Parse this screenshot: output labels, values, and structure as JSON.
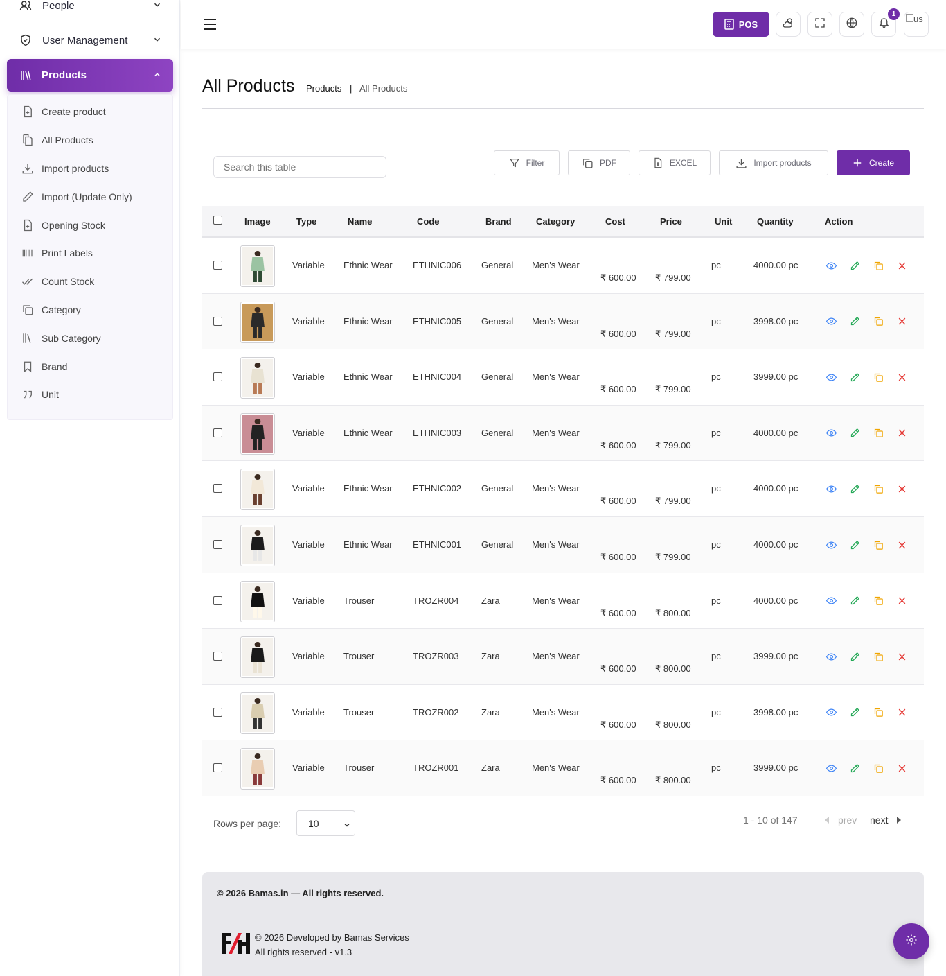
{
  "sidebar": {
    "top_items": [
      {
        "label": "People"
      },
      {
        "label": "User Management"
      }
    ],
    "active": {
      "label": "Products"
    },
    "sub_items": [
      {
        "label": "Create product"
      },
      {
        "label": "All Products"
      },
      {
        "label": "Import products"
      },
      {
        "label": "Import (Update Only)"
      },
      {
        "label": "Opening Stock"
      },
      {
        "label": "Print Labels"
      },
      {
        "label": "Count Stock"
      },
      {
        "label": "Category"
      },
      {
        "label": "Sub Category"
      },
      {
        "label": "Brand"
      },
      {
        "label": "Unit"
      }
    ]
  },
  "header": {
    "pos_label": "POS",
    "notification_count": "1",
    "avatar_alt": "us"
  },
  "page": {
    "title": "All Products",
    "breadcrumb": [
      "Products",
      "|",
      "All Products"
    ]
  },
  "toolbar": {
    "search_placeholder": "Search this table",
    "filter_label": "Filter",
    "pdf_label": "PDF",
    "excel_label": "EXCEL",
    "import_label": "Import products",
    "create_label": "Create"
  },
  "table": {
    "columns": [
      "Image",
      "Type",
      "Name",
      "Code",
      "Brand",
      "Category",
      "Cost",
      "Price",
      "Unit",
      "Quantity",
      "Action"
    ],
    "rows": [
      {
        "type": "Variable",
        "name": "Ethnic Wear",
        "code": "ETHNIC006",
        "brand": "General",
        "category": "Men's Wear",
        "cost": "₹ 600.00",
        "price": "₹ 799.00",
        "unit": "pc",
        "quantity": "4000.00 pc"
      },
      {
        "type": "Variable",
        "name": "Ethnic Wear",
        "code": "ETHNIC005",
        "brand": "General",
        "category": "Men's Wear",
        "cost": "₹ 600.00",
        "price": "₹ 799.00",
        "unit": "pc",
        "quantity": "3998.00 pc"
      },
      {
        "type": "Variable",
        "name": "Ethnic Wear",
        "code": "ETHNIC004",
        "brand": "General",
        "category": "Men's Wear",
        "cost": "₹ 600.00",
        "price": "₹ 799.00",
        "unit": "pc",
        "quantity": "3999.00 pc"
      },
      {
        "type": "Variable",
        "name": "Ethnic Wear",
        "code": "ETHNIC003",
        "brand": "General",
        "category": "Men's Wear",
        "cost": "₹ 600.00",
        "price": "₹ 799.00",
        "unit": "pc",
        "quantity": "4000.00 pc"
      },
      {
        "type": "Variable",
        "name": "Ethnic Wear",
        "code": "ETHNIC002",
        "brand": "General",
        "category": "Men's Wear",
        "cost": "₹ 600.00",
        "price": "₹ 799.00",
        "unit": "pc",
        "quantity": "4000.00 pc"
      },
      {
        "type": "Variable",
        "name": "Ethnic Wear",
        "code": "ETHNIC001",
        "brand": "General",
        "category": "Men's Wear",
        "cost": "₹ 600.00",
        "price": "₹ 799.00",
        "unit": "pc",
        "quantity": "4000.00 pc"
      },
      {
        "type": "Variable",
        "name": "Trouser",
        "code": "TROZR004",
        "brand": "Zara",
        "category": "Men's Wear",
        "cost": "₹ 600.00",
        "price": "₹ 800.00",
        "unit": "pc",
        "quantity": "4000.00 pc"
      },
      {
        "type": "Variable",
        "name": "Trouser",
        "code": "TROZR003",
        "brand": "Zara",
        "category": "Men's Wear",
        "cost": "₹ 600.00",
        "price": "₹ 800.00",
        "unit": "pc",
        "quantity": "3999.00 pc"
      },
      {
        "type": "Variable",
        "name": "Trouser",
        "code": "TROZR002",
        "brand": "Zara",
        "category": "Men's Wear",
        "cost": "₹ 600.00",
        "price": "₹ 800.00",
        "unit": "pc",
        "quantity": "3998.00 pc"
      },
      {
        "type": "Variable",
        "name": "Trouser",
        "code": "TROZR001",
        "brand": "Zara",
        "category": "Men's Wear",
        "cost": "₹ 600.00",
        "price": "₹ 800.00",
        "unit": "pc",
        "quantity": "3999.00 pc"
      }
    ]
  },
  "pagination": {
    "rows_label": "Rows per page:",
    "rows_value": "10",
    "info": "1 - 10 of 147",
    "prev_label": "prev",
    "next_label": "next"
  },
  "footer": {
    "copyright": "© 2026 Bamas.in — All rights reserved.",
    "dev_line1": "© 2026 Developed by Bamas Services",
    "dev_line2": "All rights reserved - v1.3"
  },
  "colors": {
    "accent": "#6f2da8",
    "view": "#3b82f6",
    "edit": "#22a855",
    "copy": "#f0a500",
    "delete": "#e53935"
  },
  "icons": {
    "row_actions": [
      "eye-icon",
      "pencil-icon",
      "copy-icon",
      "close-icon"
    ]
  }
}
